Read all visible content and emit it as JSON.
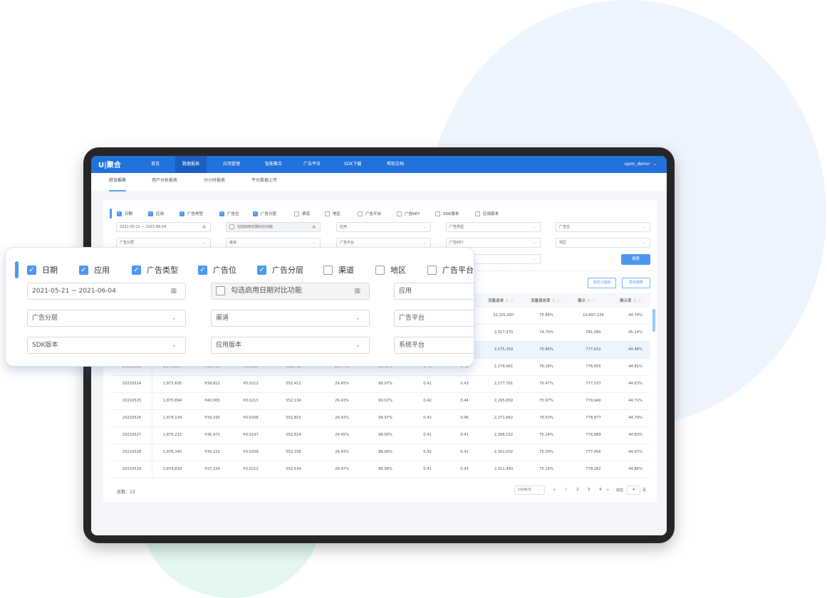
{
  "brand": {
    "logo": "U|聚合",
    "accent": "#2271dc"
  },
  "nav": {
    "items": [
      "首页",
      "数据报表",
      "应用管理",
      "智能聚合",
      "广告平台",
      "SDK下载",
      "帮助文档"
    ],
    "active": 1,
    "user": "upon_demo"
  },
  "subnav": {
    "items": [
      "综合报表",
      "用户分析报表",
      "分小时报表",
      "平台数据上传"
    ],
    "active": 0
  },
  "filters": {
    "checkboxes": [
      {
        "label": "日期",
        "checked": true
      },
      {
        "label": "应用",
        "checked": true
      },
      {
        "label": "广告类型",
        "checked": true
      },
      {
        "label": "广告位",
        "checked": true
      },
      {
        "label": "广告分层",
        "checked": true
      },
      {
        "label": "渠道",
        "checked": false
      },
      {
        "label": "地区",
        "checked": false
      },
      {
        "label": "广告平台",
        "checked": false
      },
      {
        "label": "广告KEY",
        "checked": false
      },
      {
        "label": "SDK版本",
        "checked": false
      },
      {
        "label": "应用版本",
        "checked": false
      }
    ],
    "date_range": "2021-05-21 ~ 2021-06-04",
    "compare_label": "勾选启用日期对比功能",
    "selects_row1": [
      "应用",
      "广告类型",
      "广告位"
    ],
    "selects_row2": [
      "广告分层",
      "渠道",
      "广告平台",
      "广告KEY",
      "地区"
    ],
    "search_label": "搜索"
  },
  "actions": {
    "custom_metrics": "自定义指标",
    "export": "导出报表"
  },
  "table": {
    "headers": [
      "流量请求",
      "流量填充率",
      "展示",
      "展示率"
    ],
    "rows": [
      [
        "",
        "",
        "",
        "",
        "",
        "",
        "",
        "",
        "",
        "32,101,697",
        "75.86%",
        "10,897,234",
        "44.74%"
      ],
      [
        "",
        "",
        "",
        "",
        "",
        "",
        "",
        "",
        "",
        "2,317,370",
        "74.70%",
        "781,580",
        "45.14%"
      ],
      [
        "",
        "",
        "",
        "",
        "",
        "",
        "",
        "",
        "",
        "2,275,359",
        "76.86%",
        "777,632",
        "44.46%"
      ],
      [
        "20210523",
        "1,875,314",
        "¥36,729",
        "¥0.0195",
        "552,762",
        "29.47%",
        "98.99%",
        "0.41",
        "0.42",
        "2,274,961",
        "76.18%",
        "776,655",
        "44.81%"
      ],
      [
        "20210524",
        "1,875,605",
        "¥39,812",
        "¥0.0212",
        "552,411",
        "29.45%",
        "98.97%",
        "0.41",
        "0.43",
        "2,277,781",
        "76.47%",
        "777,537",
        "44.63%"
      ],
      [
        "20210525",
        "1,875,894",
        "¥40,065",
        "¥0.0213",
        "552,134",
        "29.43%",
        "99.02%",
        "0.42",
        "0.44",
        "2,295,850",
        "75.97%",
        "779,940",
        "44.71%"
      ],
      [
        "20210526",
        "1,878,134",
        "¥39,195",
        "¥0.0208",
        "552,810",
        "29.43%",
        "98.97%",
        "0.42",
        "0.46",
        "2,271,662",
        "76.53%",
        "778,877",
        "44.79%"
      ],
      [
        "20210527",
        "1,876,215",
        "¥36,973",
        "¥0.0197",
        "552,614",
        "29.45%",
        "98.90%",
        "0.41",
        "0.41",
        "2,306,152",
        "75.14%",
        "776,889",
        "44.83%"
      ],
      [
        "20210528",
        "1,876,345",
        "¥39,221",
        "¥0.0209",
        "552,338",
        "29.43%",
        "98.90%",
        "0.42",
        "0.42",
        "2,302,032",
        "75.09%",
        "777,456",
        "44.97%"
      ],
      [
        "20210529",
        "1,874,829",
        "¥37,224",
        "¥0.0212",
        "552,534",
        "29.47%",
        "98.98%",
        "0.41",
        "0.43",
        "2,311,450",
        "75.14%",
        "779,282",
        "44.86%"
      ]
    ],
    "highlighted_row": 2
  },
  "footer": {
    "total": "总数：13",
    "page_size": "100条/页",
    "pages": [
      "1",
      "2",
      "3",
      "4"
    ],
    "current_page": "1",
    "goto_label": "前往",
    "goto_value": "4",
    "page_unit": "页"
  },
  "overlay": {
    "checkboxes": [
      {
        "label": "日期",
        "checked": true
      },
      {
        "label": "应用",
        "checked": true
      },
      {
        "label": "广告类型",
        "checked": true
      },
      {
        "label": "广告位",
        "checked": true
      },
      {
        "label": "广告分层",
        "checked": true
      },
      {
        "label": "渠道",
        "checked": false
      },
      {
        "label": "地区",
        "checked": false
      },
      {
        "label": "广告平台",
        "checked": false
      }
    ],
    "date_range": "2021-05-21 ~ 2021-06-04",
    "compare_label": "勾选启用日期对比功能",
    "app": "应用",
    "row2": [
      "广告分层",
      "渠道",
      "广告平台"
    ],
    "row3": [
      "SDK版本",
      "应用版本",
      "系统平台"
    ]
  }
}
